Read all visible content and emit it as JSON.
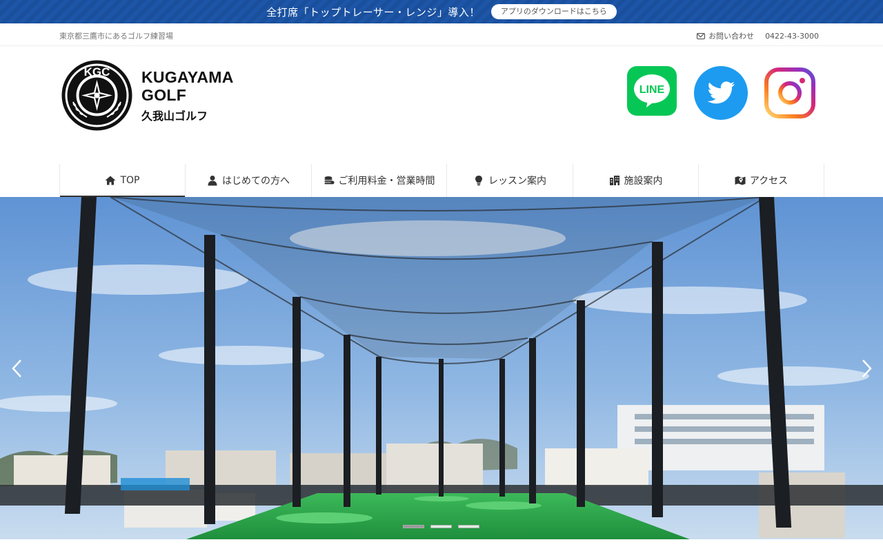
{
  "announcement": {
    "text": "全打席「トップトレーサー・レンジ」導入！",
    "button_label": "アプリのダウンロードはこちら"
  },
  "infobar": {
    "tagline": "東京都三鷹市にあるゴルフ練習場",
    "contact_label": "お問い合わせ",
    "phone": "0422-43-3000"
  },
  "logo": {
    "emblem_text": "KGC",
    "name_en_line1": "KUGAYAMA",
    "name_en_line2": "GOLF",
    "name_ja": "久我山ゴルフ"
  },
  "social": {
    "line_label": "LINE",
    "line_color": "#06c755",
    "twitter_color": "#1d9bf0",
    "instagram_colors": [
      "#feda75",
      "#fa7e1e",
      "#d62976",
      "#962fbf",
      "#4f5bd5"
    ]
  },
  "nav": {
    "items": [
      {
        "label": "TOP",
        "icon": "home-icon"
      },
      {
        "label": "はじめての方へ",
        "icon": "user-icon"
      },
      {
        "label": "ご利用料金・営業時間",
        "icon": "coins-icon"
      },
      {
        "label": "レッスン案内",
        "icon": "lightbulb-icon"
      },
      {
        "label": "施設案内",
        "icon": "building-icon"
      },
      {
        "label": "アクセス",
        "icon": "map-icon"
      }
    ]
  },
  "slider": {
    "slide_count": 3,
    "active_slide": 1
  },
  "colors": {
    "announce_bar": "#1a4f9c",
    "sky": "#7aa9dc",
    "turf": "#2fa84a"
  }
}
